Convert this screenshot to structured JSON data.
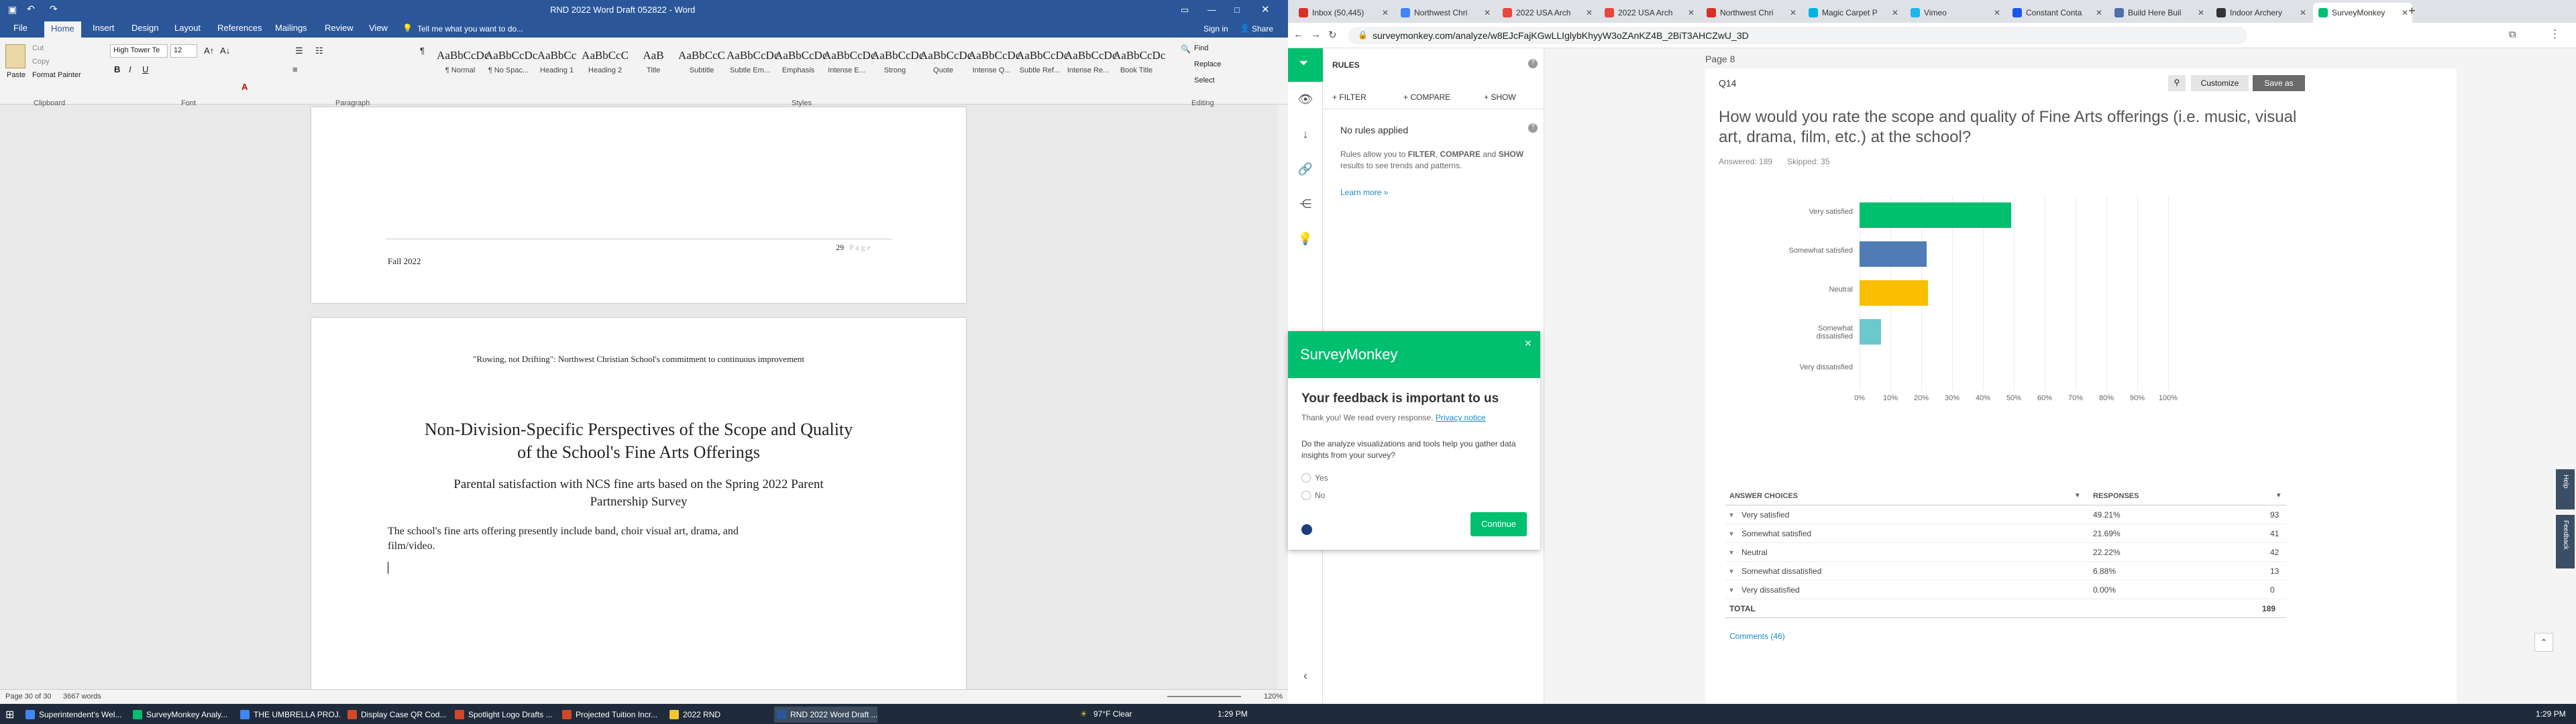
{
  "word": {
    "window_title": "RND 2022 Word Draft 052822 - Word",
    "signin": "Sign in",
    "share": "Share",
    "tabs": [
      "File",
      "Home",
      "Insert",
      "Design",
      "Layout",
      "References",
      "Mailings",
      "Review",
      "View"
    ],
    "tell_me": "Tell me what you want to do...",
    "clipboard": {
      "paste": "Paste",
      "cut": "Cut",
      "copy": "Copy",
      "format_painter": "Format Painter",
      "group": "Clipboard"
    },
    "font": {
      "name": "High Tower Te",
      "size": "12",
      "group": "Font"
    },
    "paragraph_group": "Paragraph",
    "styles_group": "Styles",
    "styles": [
      {
        "sample": "AaBbCcDc",
        "label": "¶ Normal"
      },
      {
        "sample": "AaBbCcDc",
        "label": "¶ No Spac..."
      },
      {
        "sample": "AaBbCc",
        "label": "Heading 1"
      },
      {
        "sample": "AaBbCcC",
        "label": "Heading 2"
      },
      {
        "sample": "AaB",
        "label": "Title"
      },
      {
        "sample": "AaBbCcC",
        "label": "Subtitle"
      },
      {
        "sample": "AaBbCcDc",
        "label": "Subtle Em..."
      },
      {
        "sample": "AaBbCcDc",
        "label": "Emphasis"
      },
      {
        "sample": "AaBbCcDc",
        "label": "Intense E..."
      },
      {
        "sample": "AaBbCcDc",
        "label": "Strong"
      },
      {
        "sample": "AaBbCcDc",
        "label": "Quote"
      },
      {
        "sample": "AaBbCcDc",
        "label": "Intense Q..."
      },
      {
        "sample": "AaBbCcDc",
        "label": "Subtle Ref..."
      },
      {
        "sample": "AaBbCcDc",
        "label": "Intense Re..."
      },
      {
        "sample": "AaBbCcDc",
        "label": "Book Title"
      }
    ],
    "editing": {
      "find": "Find",
      "replace": "Replace",
      "select": "Select",
      "group": "Editing"
    },
    "page1": {
      "footer_left": "Fall 2022",
      "page_num": "29",
      "page_word": "P a g e"
    },
    "page2": {
      "header": "\"Rowing, not Drifting\": Northwest Christian School's commitment to continuous improvement",
      "title_line1": "Non-Division-Specific Perspectives of the Scope and Quality",
      "title_line2": "of the School's Fine Arts Offerings",
      "subtitle_line1": "Parental satisfaction with NCS fine arts based on the Spring 2022 Parent",
      "subtitle_line2": "Partnership Survey",
      "body_line1": "The school's fine arts offering presently include band, choir visual art, drama, and",
      "body_line2": "film/video."
    },
    "status": {
      "page": "Page 30 of 30",
      "words": "3667 words",
      "zoom": "120%"
    }
  },
  "browser": {
    "tabs": [
      {
        "label": "Inbox (50,445)",
        "color": "#d93025"
      },
      {
        "label": "Northwest Chri",
        "color": "#4285f4"
      },
      {
        "label": "2022 USA Arch",
        "color": "#e8453c"
      },
      {
        "label": "2022 USA Arch",
        "color": "#e8453c"
      },
      {
        "label": "Northwest Chri",
        "color": "#d93025"
      },
      {
        "label": "Magic Carpet P",
        "color": "#00b3e3"
      },
      {
        "label": "Vimeo",
        "color": "#1ab7ea"
      },
      {
        "label": "Constant Conta",
        "color": "#1856ed"
      },
      {
        "label": "Build Here Buil",
        "color": "#4f6fa8"
      },
      {
        "label": "Indoor Archery",
        "color": "#333333"
      },
      {
        "label": "SurveyMonkey",
        "color": "#00bf6f"
      }
    ],
    "url": "surveymonkey.com/analyze/w8EJcFajKGwLLIglybKhyyW3oZAnKZ4B_2BiT3AHCZwU_3D"
  },
  "survey": {
    "rules_title": "RULES",
    "filter": "+ FILTER",
    "compare": "+ COMPARE",
    "show": "+ SHOW",
    "no_rules": "No rules applied",
    "rules_text_1": "Rules allow you to",
    "rules_kw_1": "FILTER",
    "rules_kw_2": "COMPARE",
    "rules_and": "and",
    "rules_kw_3": "SHOW",
    "rules_text_2": "results to see trends and patterns.",
    "learn_more": "Learn more »",
    "page_label": "Page 8",
    "q_label": "Q14",
    "customize": "Customize",
    "save_as": "Save as",
    "question": "How would you rate the scope and quality of Fine Arts offerings (i.e. music, visual art, drama, film, etc.) at the school?",
    "answered": "Answered: 189",
    "skipped": "Skipped: 35",
    "table": {
      "col1": "ANSWER CHOICES",
      "col2": "RESPONSES",
      "rows": [
        {
          "choice": "Very satisfied",
          "pct": "49.21%",
          "n": "93"
        },
        {
          "choice": "Somewhat satisfied",
          "pct": "21.69%",
          "n": "41"
        },
        {
          "choice": "Neutral",
          "pct": "22.22%",
          "n": "42"
        },
        {
          "choice": "Somewhat dissatisfied",
          "pct": "6.88%",
          "n": "13"
        },
        {
          "choice": "Very dissatisfied",
          "pct": "0.00%",
          "n": "0"
        }
      ],
      "total_label": "TOTAL",
      "total": "189"
    },
    "comments": "Comments (46)",
    "help": "Help",
    "feedback": "Feedback"
  },
  "popup": {
    "brand": "SurveyMonkey",
    "heading": "Your feedback is important to us",
    "thanks": "Thank you! We read every response.",
    "privacy": "Privacy notice",
    "question": "Do the analyze visualizations and tools help you gather data insights from your survey?",
    "yes": "Yes",
    "no": "No",
    "continue": "Continue"
  },
  "chart_data": {
    "type": "bar",
    "orientation": "horizontal",
    "categories": [
      "Very satisfied",
      "Somewhat satisfied",
      "Neutral",
      "Somewhat dissatisfied",
      "Very dissatisfied"
    ],
    "values": [
      49.21,
      21.69,
      22.22,
      6.88,
      0
    ],
    "colors": [
      "#00bf6f",
      "#507cb6",
      "#f9be00",
      "#6bc8cd",
      "#8bb2e0"
    ],
    "xticks": [
      "0%",
      "10%",
      "20%",
      "30%",
      "40%",
      "50%",
      "60%",
      "70%",
      "80%",
      "90%",
      "100%"
    ],
    "xlim": [
      0,
      100
    ],
    "grid": true
  },
  "taskbar": {
    "items": [
      {
        "label": "Superintendent's Wel...",
        "color": "#4285f4"
      },
      {
        "label": "SurveyMonkey Analy...",
        "color": "#00bf6f"
      },
      {
        "label": "THE UMBRELLA PROJ...",
        "color": "#4285f4"
      },
      {
        "label": "Display Case QR Cod...",
        "color": "#d24726"
      },
      {
        "label": "Spotlight Logo Drafts ...",
        "color": "#d24726"
      },
      {
        "label": "Projected Tuition Incr...",
        "color": "#d24726"
      },
      {
        "label": "2022 RND",
        "color": "#f4c430"
      },
      {
        "label": "RND 2022 Word Draft ...",
        "color": "#2b579a"
      }
    ],
    "weather": "97°F Clear",
    "time": "1:29 PM"
  }
}
